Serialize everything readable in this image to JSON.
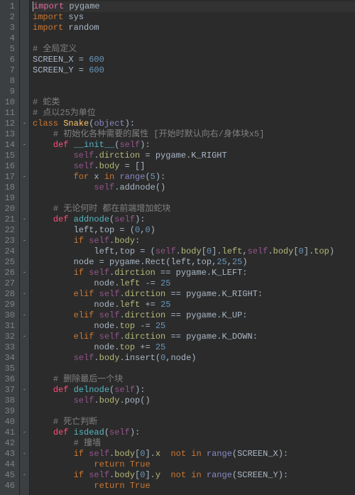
{
  "gutter": [
    "1",
    "2",
    "3",
    "4",
    "5",
    "6",
    "7",
    "8",
    "9",
    "10",
    "11",
    "12",
    "13",
    "14",
    "15",
    "16",
    "17",
    "18",
    "19",
    "20",
    "21",
    "22",
    "23",
    "24",
    "25",
    "26",
    "27",
    "28",
    "29",
    "30",
    "31",
    "32",
    "33",
    "34",
    "35",
    "36",
    "37",
    "38",
    "39",
    "40",
    "41",
    "42",
    "43",
    "44",
    "45",
    "46"
  ],
  "fold": [
    "",
    "",
    "",
    "",
    "",
    "",
    "",
    "",
    "",
    "",
    "",
    "-",
    "",
    "-",
    "",
    "",
    "-",
    "",
    "",
    "",
    "-",
    "",
    "-",
    "",
    "",
    "-",
    "",
    "-",
    "",
    "-",
    "",
    "-",
    "",
    "",
    "",
    "",
    "-",
    "",
    "",
    "",
    "-",
    "",
    "-",
    "",
    "-",
    ""
  ],
  "code": {
    "l1": {
      "kw": "import",
      "mod": "pygame"
    },
    "l2": {
      "kw": "import",
      "mod": "sys"
    },
    "l3": {
      "kw": "import",
      "mod": "random"
    },
    "l5": "# 全局定义",
    "l6": {
      "name": "SCREEN_X",
      "eq": " = ",
      "val": "600"
    },
    "l7": {
      "name": "SCREEN_Y",
      "eq": " = ",
      "val": "600"
    },
    "l10": "# 蛇类",
    "l11": "# 点以25为单位",
    "l12": {
      "kw": "class",
      "name": "Snake",
      "args": "object"
    },
    "l13": "# 初始化各种需要的属性 [开始时默认向右/身体块x5]",
    "l14": {
      "kw": "def",
      "name": "__init__",
      "args": "self"
    },
    "l15": {
      "lhs": "self",
      "dot": ".",
      "attr": "dirction",
      "eq": " = ",
      "mod": "pygame",
      "dot2": ".",
      "const": "K_RIGHT"
    },
    "l16": {
      "lhs": "self",
      "dot": ".",
      "attr": "body",
      "eq": " = ",
      "val": "[]"
    },
    "l17": {
      "kw": "for",
      "var": "x",
      "kw2": "in",
      "fn": "range",
      "args": "5"
    },
    "l18": {
      "lhs": "self",
      "dot": ".",
      "fn": "addnode",
      "paren": "()"
    },
    "l20": "# 无论何时 都在前端增加蛇块",
    "l21": {
      "kw": "def",
      "name": "addnode",
      "args": "self"
    },
    "l22": {
      "lhs": "left",
      "comma": ",",
      "lhs2": "top",
      "eq": " = ",
      "val": "(",
      "n1": "0",
      "c2": ",",
      "n2": "0",
      "close": ")"
    },
    "l23": {
      "kw": "if",
      "lhs": "self",
      "dot": ".",
      "attr": "body",
      "colon": ":"
    },
    "l24": {
      "lhs": "left",
      "c1": ",",
      "lhs2": "top",
      "eq": " = ",
      "open": "(",
      "s": "self",
      "d": ".",
      "a": "body",
      "br": "[",
      "n": "0",
      "br2": "].",
      "a2": "left",
      "c2": ",",
      "s2": "self",
      "d2": ".",
      "a3": "body",
      "br3": "[",
      "n2": "0",
      "br4": "].",
      "a4": "top",
      "close": ")"
    },
    "l25": {
      "lhs": "node",
      "eq": " = ",
      "mod": "pygame",
      "dot": ".",
      "cls": "Rect",
      "open": "(",
      "a": "left",
      "c": ",",
      "b": "top",
      "c2": ",",
      "n1": "25",
      "c3": ",",
      "n2": "25",
      "close": ")"
    },
    "l26": {
      "kw": "if",
      "s": "self",
      "d": ".",
      "a": "dirction",
      "op": " == ",
      "m": "pygame",
      "d2": ".",
      "const": "K_LEFT",
      "colon": ":"
    },
    "l27": {
      "lhs": "node",
      "d": ".",
      "a": "left",
      "op": " -= ",
      "n": "25"
    },
    "l28": {
      "kw": "elif",
      "s": "self",
      "d": ".",
      "a": "dirction",
      "op": " == ",
      "m": "pygame",
      "d2": ".",
      "const": "K_RIGHT",
      "colon": ":"
    },
    "l29": {
      "lhs": "node",
      "d": ".",
      "a": "left",
      "op": " += ",
      "n": "25"
    },
    "l30": {
      "kw": "elif",
      "s": "self",
      "d": ".",
      "a": "dirction",
      "op": " == ",
      "m": "pygame",
      "d2": ".",
      "const": "K_UP",
      "colon": ":"
    },
    "l31": {
      "lhs": "node",
      "d": ".",
      "a": "top",
      "op": " -= ",
      "n": "25"
    },
    "l32": {
      "kw": "elif",
      "s": "self",
      "d": ".",
      "a": "dirction",
      "op": " == ",
      "m": "pygame",
      "d2": ".",
      "const": "K_DOWN",
      "colon": ":"
    },
    "l33": {
      "lhs": "node",
      "d": ".",
      "a": "top",
      "op": " += ",
      "n": "25"
    },
    "l34": {
      "s": "self",
      "d": ".",
      "a": "body",
      "d2": ".",
      "fn": "insert",
      "open": "(",
      "n": "0",
      "c": ",",
      "arg": "node",
      "close": ")"
    },
    "l36": "# 删除最后一个块",
    "l37": {
      "kw": "def",
      "name": "delnode",
      "args": "self"
    },
    "l38": {
      "s": "self",
      "d": ".",
      "a": "body",
      "d2": ".",
      "fn": "pop",
      "paren": "()"
    },
    "l40": "# 死亡判断",
    "l41": {
      "kw": "def",
      "name": "isdead",
      "args": "self"
    },
    "l42": "# 撞墙",
    "l43": {
      "kw": "if",
      "s": "self",
      "d": ".",
      "a": "body",
      "br": "[",
      "n": "0",
      "br2": "].",
      "a2": "x",
      "sp": "  ",
      "kw2": "not in",
      "sp2": " ",
      "fn": "range",
      "open": "(",
      "arg": "SCREEN_X",
      "close": ")",
      ":": ":"
    },
    "l44": {
      "kw": "return",
      "val": "True"
    },
    "l45": {
      "kw": "if",
      "s": "self",
      "d": ".",
      "a": "body",
      "br": "[",
      "n": "0",
      "br2": "].",
      "a2": "y",
      "sp": "  ",
      "kw2": "not in",
      "sp2": " ",
      "fn": "range",
      "open": "(",
      "arg": "SCREEN_Y",
      "close": ")",
      ":": ":"
    },
    "l46": {
      "kw": "return",
      "val": "True"
    }
  }
}
